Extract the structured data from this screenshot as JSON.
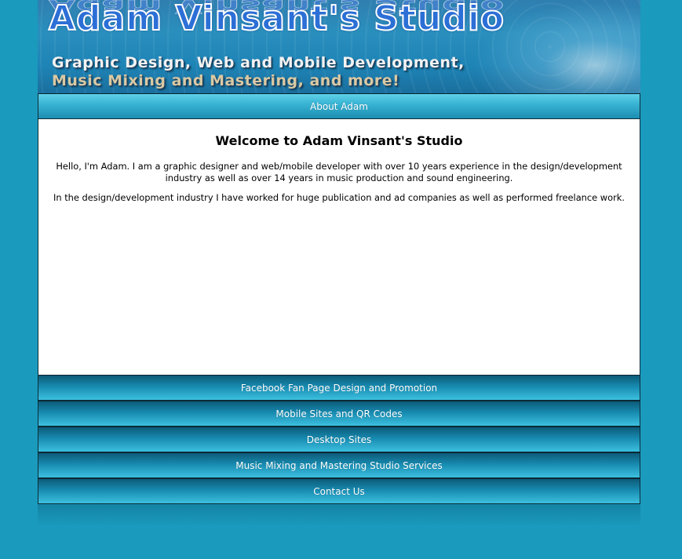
{
  "banner": {
    "title": "Adam Vinsant's Studio",
    "line1": "Graphic Design, Web and Mobile Development,",
    "line2": "Music Mixing and Mastering, and more!"
  },
  "nav_top": {
    "label": "About Adam"
  },
  "content": {
    "heading": "Welcome to Adam Vinsant's Studio",
    "paragraph1": "Hello, I'm Adam. I am a graphic designer and web/mobile developer with over 10 years experience in the design/development industry as well as over 14 years in music production and sound engineering.",
    "paragraph2": "In the design/development industry I have worked for huge publication and ad companies as well as performed freelance work."
  },
  "nav_items": [
    {
      "label": "Facebook Fan Page Design and Promotion"
    },
    {
      "label": "Mobile Sites and QR Codes"
    },
    {
      "label": "Desktop Sites"
    },
    {
      "label": "Music Mixing and Mastering Studio Services"
    },
    {
      "label": "Contact Us"
    }
  ],
  "colors": {
    "background": "#1a9abd",
    "nav_active": "#39b4d4",
    "nav_item": "#178ab0"
  }
}
